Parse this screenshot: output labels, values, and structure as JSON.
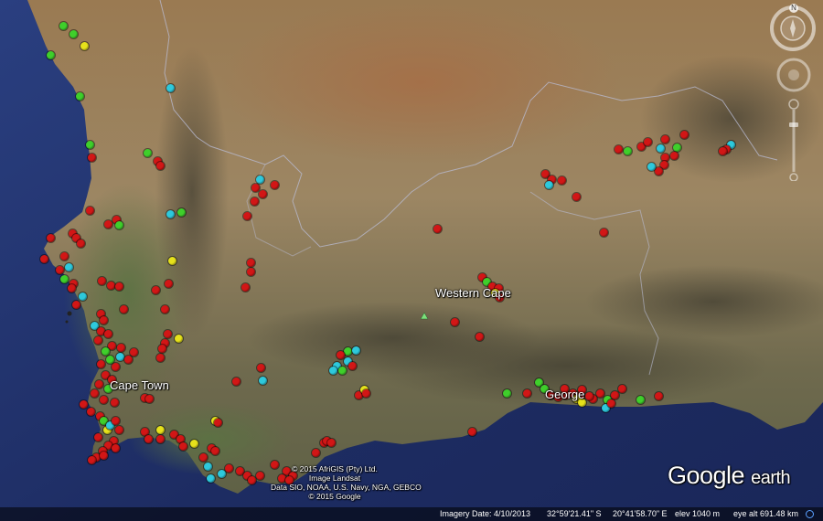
{
  "map": {
    "place_labels": {
      "province": "Western Cape",
      "city": "Cape Town",
      "town": "George"
    },
    "copyright_lines": [
      "© 2015 AfriGIS (Pty) Ltd.",
      "Image Landsat",
      "Data SIO, NOAA, U.S. Navy, NGA, GEBCO",
      "© 2015 Google"
    ],
    "logo": {
      "brand": "Google",
      "product": "earth"
    },
    "status_bar": {
      "imagery_date": "Imagery Date: 4/10/2013",
      "latitude": "32°59'21.41\" S",
      "longitude": "20°41'58.70\" E",
      "elevation": "elev  1040 m",
      "eye_altitude": "eye alt 691.48 km"
    },
    "controls": {
      "north_label": "N"
    },
    "colors": {
      "red": "#d21616",
      "green": "#3fcf2b",
      "yellow": "#e6e21b",
      "cyan": "#2ec9dc",
      "ocean": "#1e2f63",
      "land": "#8a7a5a"
    }
  }
}
